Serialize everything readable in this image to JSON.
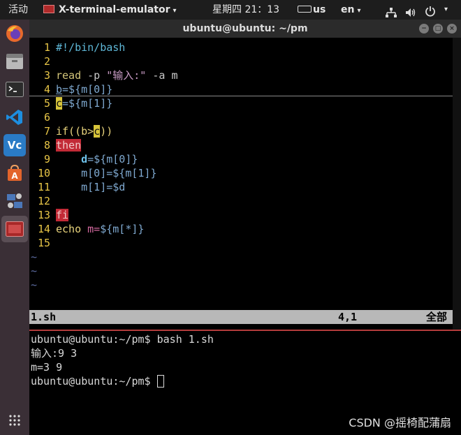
{
  "topbar": {
    "activities": "活动",
    "app_name": "X-terminal-emulator",
    "clock": "星期四 21：13",
    "keyboard_layout": "us",
    "language": "en",
    "caret": "▾",
    "network_icon": "network-icon",
    "volume_icon": "volume-icon",
    "power_icon": "power-icon"
  },
  "launcher": {
    "items": [
      {
        "name": "firefox",
        "glyph": "",
        "color": "#e8692c"
      },
      {
        "name": "files",
        "glyph": "",
        "color": "#a8a8a8"
      },
      {
        "name": "terminal",
        "glyph": ">_",
        "color": "#2b2b2b"
      },
      {
        "name": "vscode",
        "glyph": "⟨⟩",
        "color": "#1d7fd4"
      },
      {
        "name": "virtualbox",
        "glyph": "Vc",
        "color": "#2a7bc6"
      },
      {
        "name": "software",
        "glyph": "A",
        "color": "#e3642b"
      },
      {
        "name": "network-tool",
        "glyph": "⚙",
        "color": "#4b77b8"
      },
      {
        "name": "x-terminal",
        "glyph": "▣",
        "color": "#b02a2a"
      }
    ],
    "apps_grid_glyph": "⋮⋮"
  },
  "window": {
    "title": "ubuntu@ubuntu: ~/pm",
    "buttons": {
      "minimize": "−",
      "maximize": "□",
      "close": "×"
    }
  },
  "vim": {
    "lines": [
      {
        "n": "1",
        "text": "#!/bin/bash"
      },
      {
        "n": "2",
        "text": ""
      },
      {
        "n": "3",
        "read": "read",
        "opt": " -p ",
        "str": "\"输入:\"",
        "opt2": " -a ",
        "var": "m"
      },
      {
        "n": "4",
        "cur": "b",
        "rest": "=${m[0]}"
      },
      {
        "n": "5",
        "cur": "c",
        "rest": "=${m[1]}"
      },
      {
        "n": "6",
        "text": ""
      },
      {
        "n": "7",
        "pre": "if((b>",
        "cur": "c",
        "post": "))"
      },
      {
        "n": "8",
        "kw": "then"
      },
      {
        "n": "9",
        "indent": "    ",
        "var": "d",
        "rest": "=${m[0]}"
      },
      {
        "n": "10",
        "indent": "    ",
        "left": "m[0]",
        "rest": "=${m[1]}"
      },
      {
        "n": "11",
        "indent": "    ",
        "left": "m[1]",
        "rest": "=$d"
      },
      {
        "n": "12",
        "text": ""
      },
      {
        "n": "13",
        "kw": "fi"
      },
      {
        "n": "14",
        "echo": "echo",
        "var": " m=",
        "rest": "${m[*]}"
      },
      {
        "n": "15",
        "text": ""
      }
    ],
    "tildes": [
      "~",
      "~",
      "~"
    ],
    "status": {
      "filename": "1.sh",
      "position": "4,1",
      "scroll": "全部"
    }
  },
  "terminal": {
    "lines": [
      "ubuntu@ubuntu:~/pm$ bash 1.sh",
      "输入:9 3",
      "m=3 9"
    ],
    "prompt": "ubuntu@ubuntu:~/pm$ "
  },
  "watermark": "CSDN @摇椅配蒲扇"
}
